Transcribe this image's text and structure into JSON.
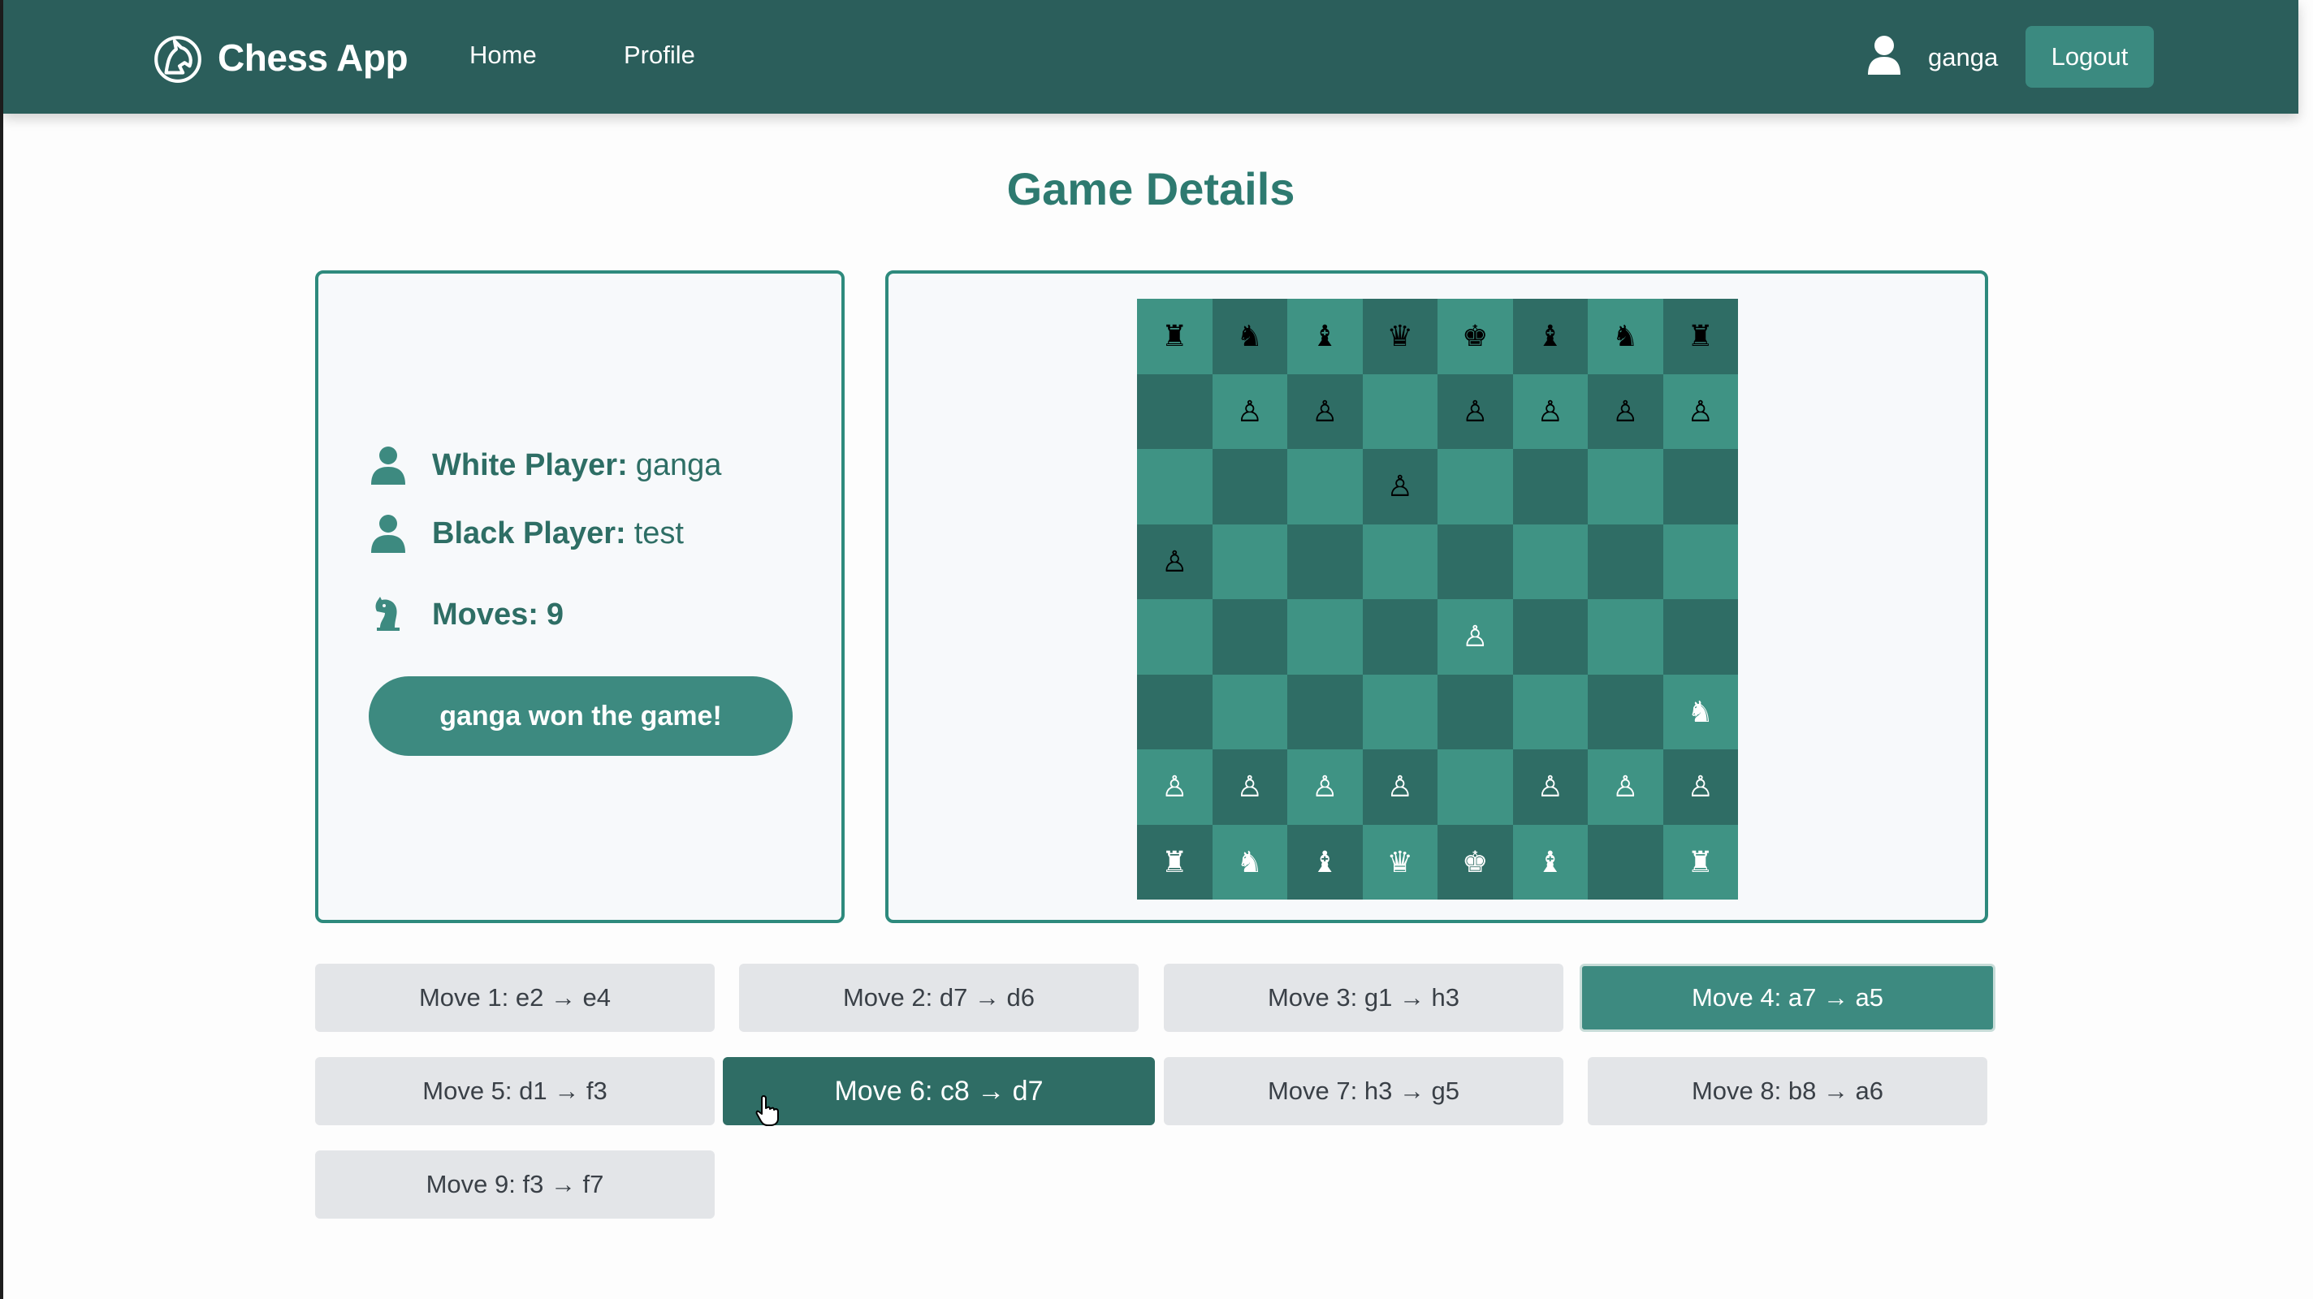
{
  "nav": {
    "brand": "Chess App",
    "home": "Home",
    "profile": "Profile",
    "username": "ganga",
    "logout": "Logout"
  },
  "page_title": "Game Details",
  "game": {
    "white_label": "White Player:",
    "white_player": "ganga",
    "black_label": "Black Player:",
    "black_player": "test",
    "moves_label": "Moves:",
    "moves_count": "9",
    "result": "ganga won the game!"
  },
  "board": {
    "rows": [
      [
        "♜",
        "♞",
        "♝",
        "♛",
        "♚",
        "♝",
        "♞",
        "♜"
      ],
      [
        "",
        "♙",
        "♙",
        "",
        "♙",
        "♙",
        "♙",
        "♙"
      ],
      [
        "",
        "",
        "",
        "♙",
        "",
        "",
        "",
        ""
      ],
      [
        "♙",
        "",
        "",
        "",
        "",
        "",
        "",
        ""
      ],
      [
        "",
        "",
        "",
        "",
        "♙",
        "",
        "",
        ""
      ],
      [
        "",
        "",
        "",
        "",
        "",
        "",
        "",
        "♞"
      ],
      [
        "♙",
        "♙",
        "♙",
        "♙",
        "",
        "♙",
        "♙",
        "♙"
      ],
      [
        "♜",
        "♞",
        "♝",
        "♛",
        "♚",
        "♝",
        "",
        "♜"
      ]
    ],
    "colors": [
      [
        "b",
        "b",
        "b",
        "b",
        "b",
        "b",
        "b",
        "b"
      ],
      [
        "",
        "b",
        "b",
        "",
        "b",
        "b",
        "b",
        "b"
      ],
      [
        "",
        "",
        "",
        "b",
        "",
        "",
        "",
        ""
      ],
      [
        "b",
        "",
        "",
        "",
        "",
        "",
        "",
        ""
      ],
      [
        "",
        "",
        "",
        "",
        "w",
        "",
        "",
        ""
      ],
      [
        "",
        "",
        "",
        "",
        "",
        "",
        "",
        "w"
      ],
      [
        "w",
        "w",
        "w",
        "w",
        "",
        "w",
        "w",
        "w"
      ],
      [
        "w",
        "w",
        "w",
        "w",
        "w",
        "w",
        "",
        "w"
      ]
    ],
    "light_color": "#3f9384",
    "dark_color": "#2f6d65"
  },
  "moves": [
    {
      "label": "Move 1: e2 → e4",
      "state": "normal"
    },
    {
      "label": "Move 2: d7 → d6",
      "state": "normal"
    },
    {
      "label": "Move 3: g1 → h3",
      "state": "normal"
    },
    {
      "label": "Move 4: a7 → a5",
      "state": "active"
    },
    {
      "label": "Move 5: d1 → f3",
      "state": "normal"
    },
    {
      "label": "Move 6: c8 → d7",
      "state": "current"
    },
    {
      "label": "Move 7: h3 → g5",
      "state": "normal"
    },
    {
      "label": "Move 8: b8 → a6",
      "state": "normal"
    },
    {
      "label": "Move 9: f3 → f7",
      "state": "normal"
    }
  ],
  "colors": {
    "navbar": "#2b5e5b",
    "accent": "#3d8a80",
    "title": "#2e7a70"
  }
}
